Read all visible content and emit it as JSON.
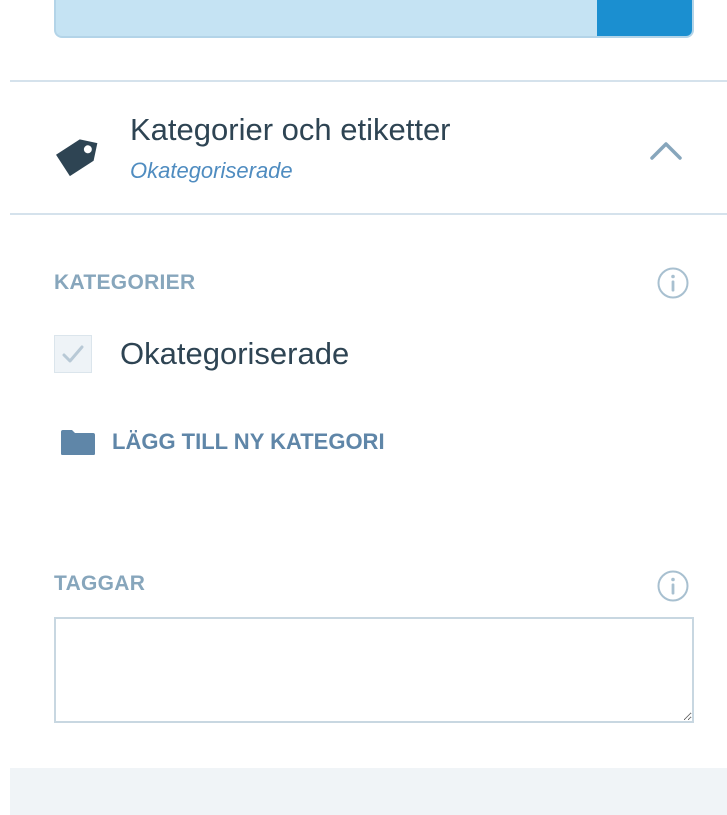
{
  "top_bar": {
    "progress_fraction": 0.85,
    "colors": {
      "track": "#c5e3f3",
      "fill": "#1b8fd0"
    }
  },
  "section": {
    "title": "Kategorier och etiketter",
    "subtitle": "Okategoriserade",
    "icons": {
      "tag": "tag-icon",
      "collapse": "chevron-up-icon"
    }
  },
  "categories": {
    "label": "KATEGORIER",
    "info_icon": "info-icon",
    "items": [
      {
        "label": "Okategoriserade",
        "checked": true
      }
    ],
    "add_button_label": "LÄGG TILL NY KATEGORI",
    "add_button_icon": "folder-icon"
  },
  "tags": {
    "label": "TAGGAR",
    "info_icon": "info-icon",
    "input_value": "",
    "input_placeholder": ""
  },
  "colors": {
    "title": "#2e4453",
    "subtitle": "#4f8cc0",
    "label": "#87a6bc",
    "link": "#5f86a8"
  }
}
